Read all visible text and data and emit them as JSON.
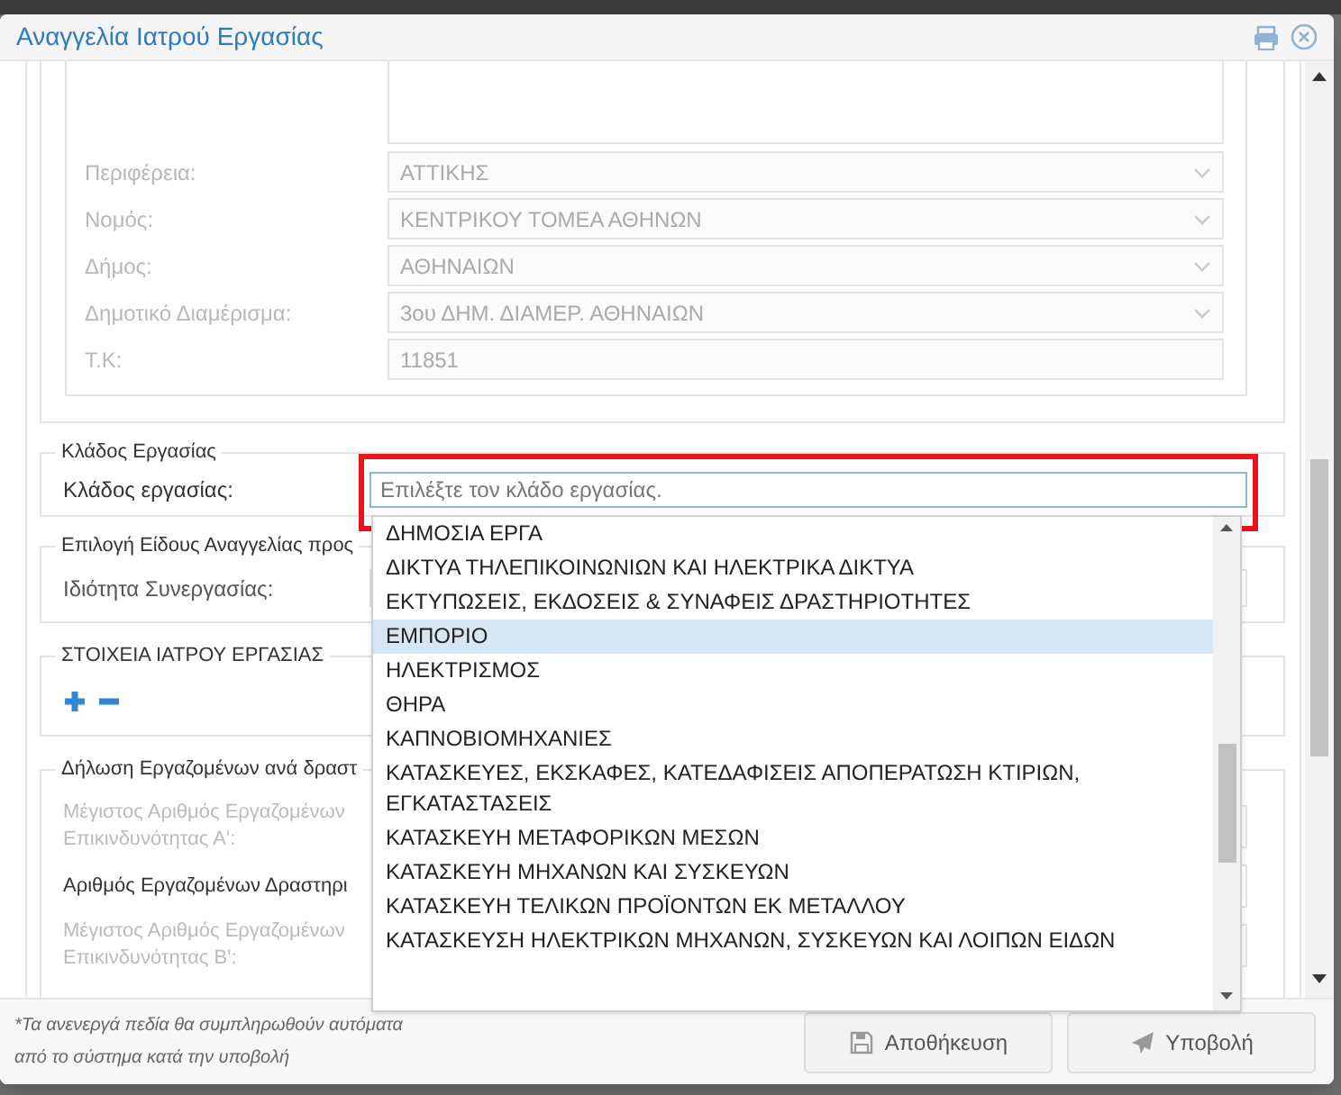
{
  "dialog": {
    "title": "Αναγγελία Ιατρού Εργασίας"
  },
  "address_fields": [
    {
      "label": "Περιφέρεια:",
      "value": "ΑΤΤΙΚΗΣ",
      "kind": "select",
      "disabled": true
    },
    {
      "label": "Νομός:",
      "value": "ΚΕΝΤΡΙΚΟΥ ΤΟΜΕΑ ΑΘΗΝΩΝ",
      "kind": "select",
      "disabled": true
    },
    {
      "label": "Δήμος:",
      "value": "ΑΘΗΝΑΙΩΝ",
      "kind": "select",
      "disabled": true
    },
    {
      "label": "Δημοτικό Διαμέρισμα:",
      "value": "3ου ΔΗΜ. ΔΙΑΜΕΡ. ΑΘΗΝΑΙΩΝ",
      "kind": "select",
      "disabled": true
    },
    {
      "label": "Τ.Κ:",
      "value": "11851",
      "kind": "text",
      "disabled": true
    }
  ],
  "sector": {
    "legend": "Κλάδος Εργασίας",
    "label": "Κλάδος εργασίας:",
    "placeholder": "Επιλέξτε τον κλάδο εργασίας.",
    "options": [
      {
        "label": "ΔΗΜΟΣΙΑ ΕΡΓΑ",
        "selected": false
      },
      {
        "label": "ΔΙΚΤΥΑ ΤΗΛΕΠΙΚΟΙΝΩΝΙΩΝ ΚΑΙ ΗΛΕΚΤΡΙΚΑ ΔΙΚΤΥΑ",
        "selected": false
      },
      {
        "label": "ΕΚΤΥΠΩΣΕΙΣ, ΕΚΔΟΣΕΙΣ & ΣΥΝΑΦΕΙΣ ΔΡΑΣΤΗΡΙΟΤΗΤΕΣ",
        "selected": false
      },
      {
        "label": "ΕΜΠΟΡΙΟ",
        "selected": true
      },
      {
        "label": "ΗΛΕΚΤΡΙΣΜΟΣ",
        "selected": false
      },
      {
        "label": "ΘΗΡΑ",
        "selected": false
      },
      {
        "label": "ΚΑΠΝΟΒΙΟΜΗΧΑΝΙΕΣ",
        "selected": false
      },
      {
        "label": "ΚΑΤΑΣΚΕΥΕΣ, ΕΚΣΚΑΦΕΣ, ΚΑΤΕΔΑΦΙΣΕΙΣ ΑΠΟΠΕΡΑΤΩΣΗ ΚΤΙΡΙΩΝ, ΕΓΚΑΤΑΣΤΑΣΕΙΣ",
        "selected": false
      },
      {
        "label": "ΚΑΤΑΣΚΕΥΗ ΜΕΤΑΦΟΡΙΚΩΝ ΜΕΣΩΝ",
        "selected": false
      },
      {
        "label": "ΚΑΤΑΣΚΕΥΗ ΜΗΧΑΝΩΝ ΚΑΙ ΣΥΣΚΕΥΩΝ",
        "selected": false
      },
      {
        "label": "ΚΑΤΑΣΚΕΥΗ ΤΕΛΙΚΩΝ ΠΡΟΪΟΝΤΩΝ ΕΚ ΜΕΤΑΛΛΟΥ",
        "selected": false
      },
      {
        "label": "ΚΑΤΑΣΚΕΥΣΗ ΗΛΕΚΤΡΙΚΩΝ ΜΗΧΑΝΩΝ, ΣΥΣΚΕΥΩΝ ΚΑΙ ΛΟΙΠΩΝ ΕΙΔΩΝ",
        "selected": false
      }
    ]
  },
  "announcement_type": {
    "legend": "Επιλογή Είδους Αναγγελίας προς",
    "label": "Ιδιότητα Συνεργασίας:"
  },
  "doctor": {
    "legend": "ΣΤΟΙΧΕΙΑ ΙΑΤΡΟΥ ΕΡΓΑΣΙΑΣ"
  },
  "employees": {
    "legend": "Δήλωση Εργαζομένων ανά δραστ",
    "rows": [
      {
        "label": "Μέγιστος Αριθμός Εργαζομένων Επικινδυνότητας Α':",
        "disabled": true
      },
      {
        "label": "Αριθμός Εργαζομένων Δραστηρι",
        "disabled": false
      },
      {
        "label": "Μέγιστος Αριθμός Εργαζομένων Επικινδυνότητας Β':",
        "disabled": true
      }
    ]
  },
  "footer": {
    "note": "*Τα ανενεργά πεδία θα συμπληρωθούν αυτόματα από το σύστημα κατά την υποβολή",
    "buttons": [
      {
        "label": "Αποθήκευση",
        "kind": "save"
      },
      {
        "label": "Υποβολή",
        "kind": "submit"
      }
    ]
  }
}
